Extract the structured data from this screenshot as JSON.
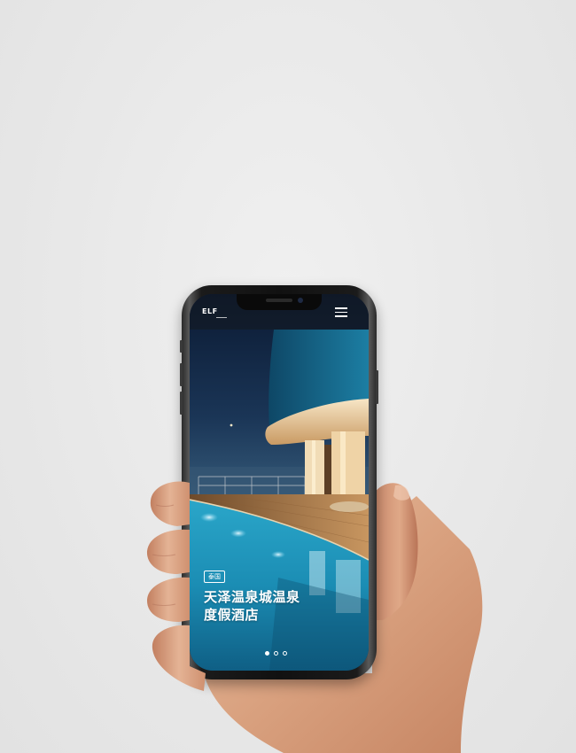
{
  "app": {
    "logo_text": "ELF"
  },
  "header": {
    "menu_icon": "hamburger-menu-icon"
  },
  "hero": {
    "tag": "泰国",
    "title_line1": "天泽温泉城温泉",
    "title_line2": "度假酒店"
  },
  "carousel": {
    "total": 3,
    "active": 1
  },
  "colors": {
    "sky": "#0d1f3c",
    "pool": "#1aa6c8",
    "deck": "#b7834b",
    "light": "#f3e2c2"
  }
}
